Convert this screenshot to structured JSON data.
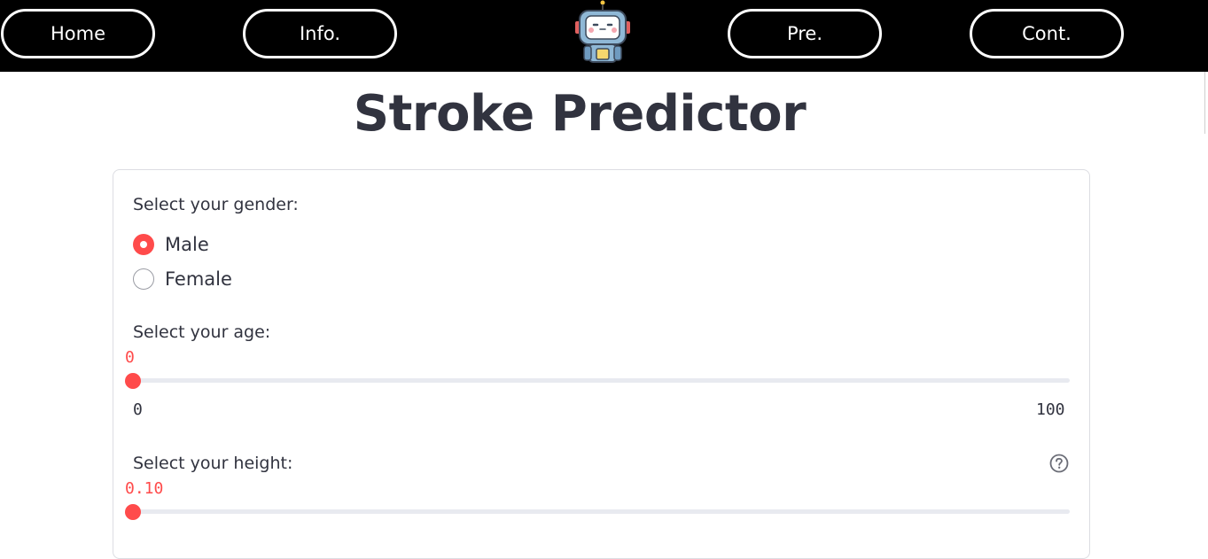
{
  "nav": {
    "home": "Home",
    "info": "Info.",
    "pre": "Pre.",
    "cont": "Cont.",
    "logo_icon": "robot-icon"
  },
  "page": {
    "title": "Stroke Predictor"
  },
  "form": {
    "gender": {
      "label": "Select your gender:",
      "options": [
        "Male",
        "Female"
      ],
      "selected": "Male"
    },
    "age": {
      "label": "Select your age:",
      "value": "0",
      "min": "0",
      "max": "100",
      "fraction": 0
    },
    "height": {
      "label": "Select your height:",
      "value": "0.10",
      "fraction": 0,
      "help_icon": "question-circle-icon"
    }
  },
  "colors": {
    "accent": "#ff4b4b",
    "navbar": "#000000",
    "text": "#31333f",
    "track": "#e8eaf0"
  }
}
